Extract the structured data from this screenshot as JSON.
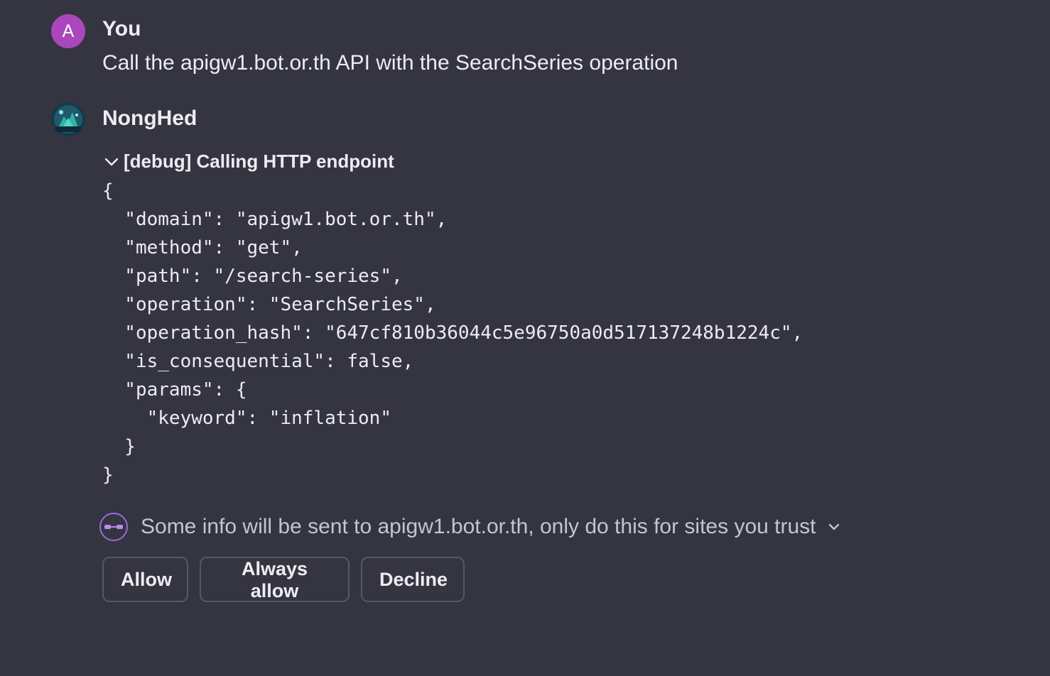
{
  "user_message": {
    "avatar_letter": "A",
    "author": "You",
    "text": "Call the apigw1.bot.or.th API with the SearchSeries operation"
  },
  "bot_message": {
    "author": "NongHed",
    "debug_label": "[debug] Calling HTTP endpoint",
    "code_lines": [
      "{",
      "  \"domain\": \"apigw1.bot.or.th\",",
      "  \"method\": \"get\",",
      "  \"path\": \"/search-series\",",
      "  \"operation\": \"SearchSeries\",",
      "  \"operation_hash\": \"647cf810b36044c5e96750a0d517137248b1224c\",",
      "  \"is_consequential\": false,",
      "  \"params\": {",
      "    \"keyword\": \"inflation\"",
      "  }",
      "}"
    ],
    "notice_text": "Some info will be sent to apigw1.bot.or.th, only do this for sites you trust",
    "notice_icon": "plugin-link-icon",
    "buttons": {
      "allow": "Allow",
      "always_allow": "Always allow",
      "decline": "Decline"
    }
  },
  "colors": {
    "background": "#343541",
    "user_avatar": "#ab47bc",
    "accent_purple": "#9b6bd8"
  }
}
